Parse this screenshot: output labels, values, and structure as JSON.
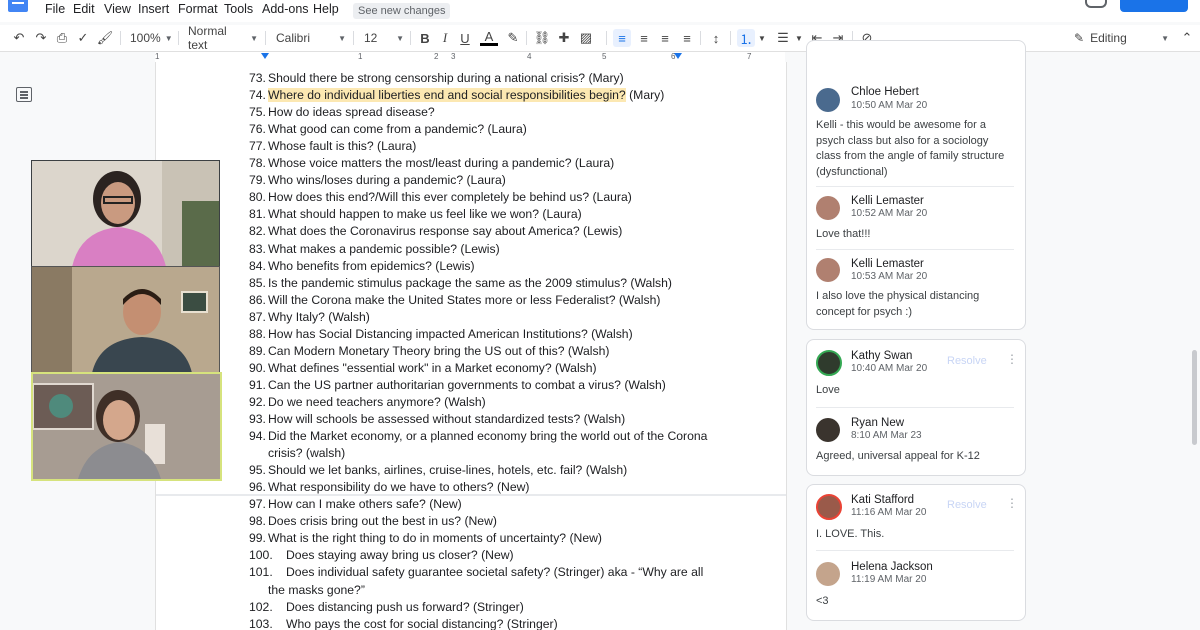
{
  "menu": [
    "File",
    "Edit",
    "View",
    "Insert",
    "Format",
    "Tools",
    "Add-ons",
    "Help"
  ],
  "see_changes": "See new changes",
  "toolbar": {
    "zoom": "100%",
    "style": "Normal text",
    "font": "Calibri",
    "size": "12",
    "bold": "B",
    "italic": "I",
    "underline": "U",
    "text_color": "A",
    "mode": "Editing"
  },
  "ruler": [
    "1",
    "1",
    "2",
    "3",
    "4",
    "5",
    "6",
    "7"
  ],
  "doc_lines": [
    {
      "num": "73.",
      "text": "Should there be strong censorship during a national crisis? (Mary)"
    },
    {
      "num": "74.",
      "text": "Where do individual liberties end and social responsibilities begin?",
      "suffix": " (Mary)"
    },
    {
      "num": "75.",
      "text": "How do ideas spread disease?"
    },
    {
      "num": "76.",
      "text": "What good can come from a pandemic? (Laura)"
    },
    {
      "num": "77.",
      "text": "Whose fault is this? (Laura)"
    },
    {
      "num": "78.",
      "text": "Whose voice matters the most/least during a pandemic? (Laura)"
    },
    {
      "num": "79.",
      "text": "Who wins/loses during a pandemic? (Laura)"
    },
    {
      "num": "80.",
      "text": "How does this end?/Will this ever completely be behind us? (Laura)"
    },
    {
      "num": "81.",
      "text": "What should happen to make us feel like we won? (Laura)"
    },
    {
      "num": "82.",
      "text": "What does the Coronavirus response say about America? (Lewis)"
    },
    {
      "num": "83.",
      "text": "What makes a pandemic possible? (Lewis)"
    },
    {
      "num": "84.",
      "text": "Who benefits from epidemics? (Lewis)"
    },
    {
      "num": "85.",
      "text": "Is the pandemic stimulus package the same as the 2009 stimulus? (Walsh)"
    },
    {
      "num": "86.",
      "text": "Will the Corona make the United States more or less Federalist? (Walsh)"
    },
    {
      "num": "87.",
      "text": "Why Italy? (Walsh)"
    },
    {
      "num": "88.",
      "text": "How has Social Distancing impacted American Institutions? (Walsh)"
    },
    {
      "num": "89.",
      "text": "Can Modern Monetary Theory bring the US out of this? (Walsh)"
    },
    {
      "num": "90.",
      "text": "What defines \"essential work\" in a Market economy? (Walsh)"
    },
    {
      "num": "91.",
      "text": "Can the US partner authoritarian governments to combat a virus? (Walsh)"
    },
    {
      "num": "92.",
      "text": "Do we need teachers anymore? (Walsh)"
    },
    {
      "num": "93.",
      "text": "How will schools be assessed without standardized tests? (Walsh)"
    },
    {
      "num": "94.",
      "text": "Did the Market economy, or a planned economy bring the world out of the Corona"
    },
    {
      "num": "",
      "text": "crisis? (walsh)"
    },
    {
      "num": "95.",
      "text": "Should we let banks, airlines, cruise-lines, hotels, etc. fail? (Walsh)"
    },
    {
      "num": "96.",
      "text": "What responsibility do we have to others? (New)"
    },
    {
      "num": "97.",
      "text": "How can I make others safe? (New)"
    },
    {
      "num": "98.",
      "text": "Does crisis bring out the best in us? (New)"
    },
    {
      "num": "99.",
      "text": "What is the right thing to do in moments of uncertainty? (New)"
    },
    {
      "num": "100.",
      "text": "Does staying away bring us closer? (New)"
    },
    {
      "num": "101.",
      "text": "Does individual safety guarantee societal safety? (Stringer) aka - “Why are all"
    },
    {
      "num": "",
      "text": "the masks gone?”"
    },
    {
      "num": "102.",
      "text": "Does distancing push us forward? (Stringer)"
    },
    {
      "num": "103.",
      "text": "Who pays the cost for social distancing? (Stringer)"
    }
  ],
  "comments": [
    {
      "name": "Chloe Hebert",
      "time": "10:50 AM Mar 20",
      "text": "Kelli - this would be awesome for a psych class but also for a sociology class from the angle of family structure (dysfunctional)"
    },
    {
      "name": "Kelli Lemaster",
      "time": "10:52 AM Mar 20",
      "text": "Love that!!!"
    },
    {
      "name": "Kelli Lemaster",
      "time": "10:53 AM Mar 20",
      "text": "I also love the physical distancing concept for psych :)"
    },
    {
      "name": "Kathy Swan",
      "time": "10:40 AM Mar 20",
      "text": "Love",
      "resolve": "Resolve"
    },
    {
      "name": "Ryan New",
      "time": "8:10 AM Mar 23",
      "text": "Agreed, universal appeal for K-12"
    },
    {
      "name": "Kati Stafford",
      "time": "11:16 AM Mar 20",
      "text": "I. LOVE. This.",
      "resolve": "Resolve"
    },
    {
      "name": "Helena Jackson",
      "time": "11:19 AM Mar 20",
      "text": "<3"
    }
  ]
}
